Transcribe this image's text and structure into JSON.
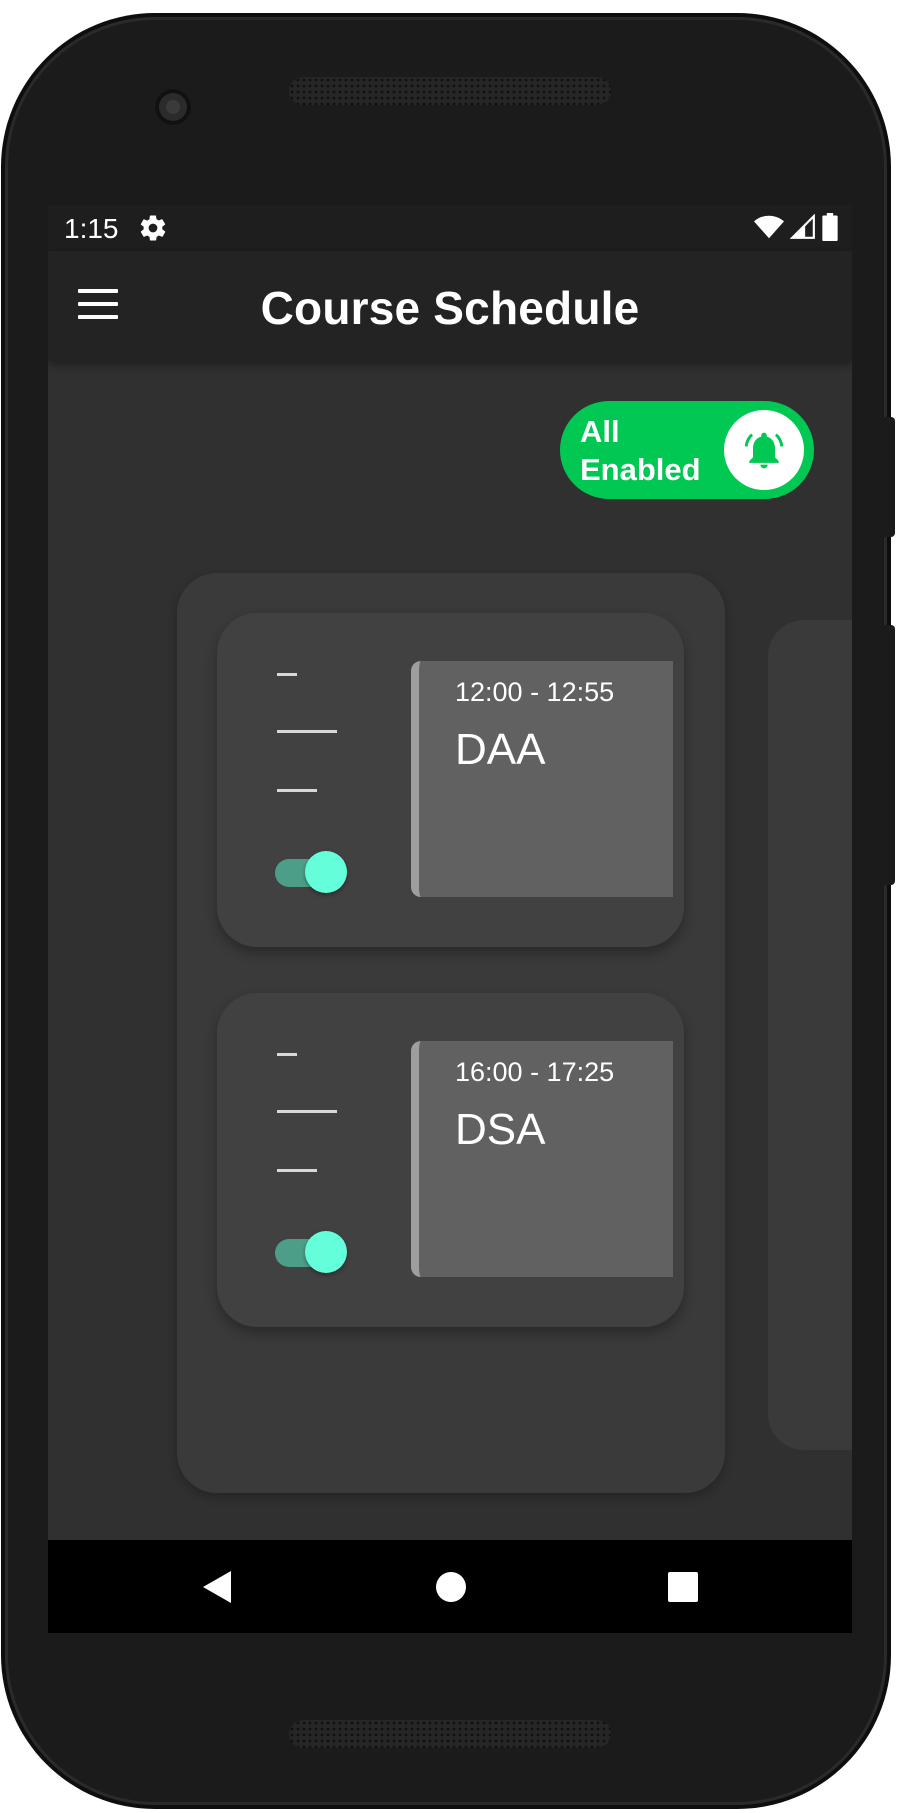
{
  "status_bar": {
    "time": "1:15",
    "icons": [
      "gear-icon",
      "wifi-icon",
      "signal-icon",
      "battery-icon"
    ]
  },
  "app_bar": {
    "title": "Course Schedule",
    "menu_icon": "hamburger-menu-icon"
  },
  "all_toggle": {
    "label": "All Enabled",
    "icon": "bell-ringing-icon",
    "color": "#00c853",
    "enabled": true
  },
  "courses": [
    {
      "time": "12:00 - 12:55",
      "name": "DAA",
      "enabled": true
    },
    {
      "time": "16:00 - 17:25",
      "name": "DSA",
      "enabled": true
    }
  ],
  "colors": {
    "accent_switch": "#64ffda",
    "screen_background": "#303030",
    "card": "#3a3a3a",
    "course_box": "#616161"
  },
  "nav_bar": {
    "icons": [
      "back-icon",
      "home-icon",
      "recents-icon"
    ]
  }
}
